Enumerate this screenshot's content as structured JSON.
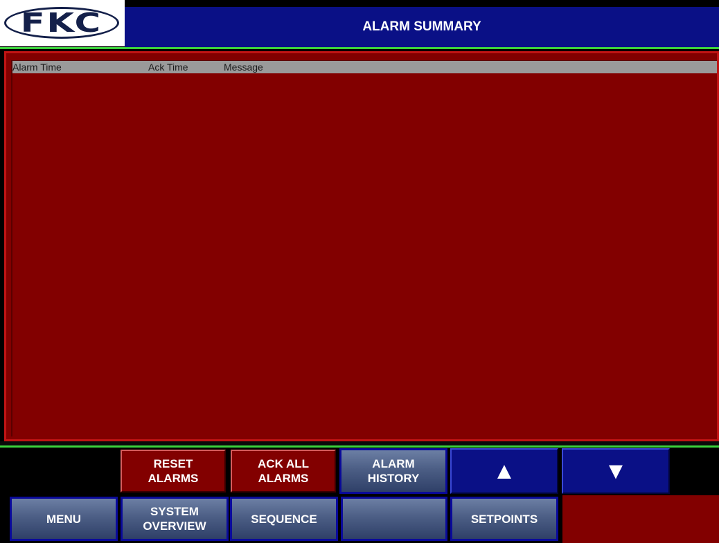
{
  "header": {
    "logo": "FKC",
    "title": "ALARM SUMMARY"
  },
  "alarm_table": {
    "columns": [
      "Alarm Time",
      "Ack Time",
      "Message"
    ],
    "rows": []
  },
  "action_buttons": {
    "reset_alarms": "RESET\nALARMS",
    "ack_all_alarms": "ACK ALL\nALARMS",
    "alarm_history": "ALARM\nHISTORY",
    "scroll_up": "▲",
    "scroll_down": "▼"
  },
  "nav_buttons": {
    "menu": "MENU",
    "system_overview": "SYSTEM\nOVERVIEW",
    "sequence": "SEQUENCE",
    "blank": "",
    "setpoints": "SETPOINTS"
  },
  "colors": {
    "title_bar": "#0a1086",
    "alarm_panel": "#820000",
    "accent_line": "#3cd23c",
    "nav_button": "#4c5e85",
    "header_row": "#9a9a9a"
  }
}
